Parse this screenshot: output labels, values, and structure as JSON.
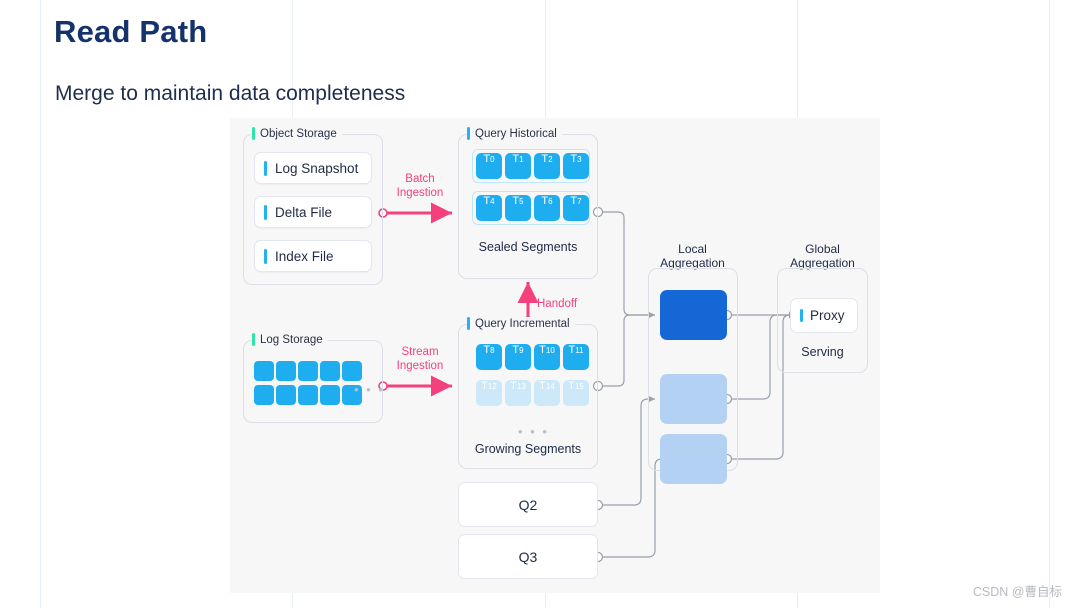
{
  "slide": {
    "title": "Read Path",
    "subtitle": "Merge to maintain data completeness",
    "watermark": "CSDN @曹自标"
  },
  "colors": {
    "title": "#14326b",
    "accent_green": "#2ee6a8",
    "accent_blue": "#22b4f2",
    "tile_blue": "#1eaef0",
    "tile_blue_faded": "#cde9f9",
    "agg_dark": "#1667d6",
    "agg_light": "#b3d2f3",
    "pink": "#f4407c",
    "canvas_bg": "#f7f7f8"
  },
  "object_storage": {
    "label": "Object Storage",
    "items": [
      {
        "label": "Log Snapshot"
      },
      {
        "label": "Delta File"
      },
      {
        "label": "Index File"
      }
    ]
  },
  "log_storage": {
    "label": "Log Storage",
    "tile_count": 10,
    "overflow_dots": "• • •"
  },
  "query_historical": {
    "label": "Query Historical",
    "caption": "Sealed Segments",
    "row1": [
      {
        "base": "T",
        "idx": "0"
      },
      {
        "base": "T",
        "idx": "1"
      },
      {
        "base": "T",
        "idx": "2"
      },
      {
        "base": "T",
        "idx": "3"
      }
    ],
    "row2": [
      {
        "base": "T",
        "idx": "4"
      },
      {
        "base": "T",
        "idx": "5"
      },
      {
        "base": "T",
        "idx": "6"
      },
      {
        "base": "T",
        "idx": "7"
      }
    ]
  },
  "query_incremental": {
    "label": "Query Incremental",
    "caption": "Growing Segments",
    "overflow_dots": "• • •",
    "row1": [
      {
        "base": "T",
        "idx": "8"
      },
      {
        "base": "T",
        "idx": "9"
      },
      {
        "base": "T",
        "idx": "10"
      },
      {
        "base": "T",
        "idx": "11"
      }
    ],
    "row2": [
      {
        "base": "T",
        "idx": "12"
      },
      {
        "base": "T",
        "idx": "13"
      },
      {
        "base": "T",
        "idx": "14"
      },
      {
        "base": "T",
        "idx": "15"
      }
    ]
  },
  "arrows": {
    "batch_ingestion_line1": "Batch",
    "batch_ingestion_line2": "Ingestion",
    "stream_ingestion_line1": "Stream",
    "stream_ingestion_line2": "Ingestion",
    "handoff": "Handoff"
  },
  "local_aggregation": {
    "title_line1": "Local",
    "title_line2": "Aggregation",
    "boxes": [
      {
        "style": "dark"
      },
      {
        "style": "light"
      },
      {
        "style": "light"
      }
    ]
  },
  "global_aggregation": {
    "title_line1": "Global",
    "title_line2": "Aggregation",
    "proxy_label": "Proxy",
    "serving_label": "Serving"
  },
  "queries": [
    {
      "label": "Q2"
    },
    {
      "label": "Q3"
    }
  ]
}
